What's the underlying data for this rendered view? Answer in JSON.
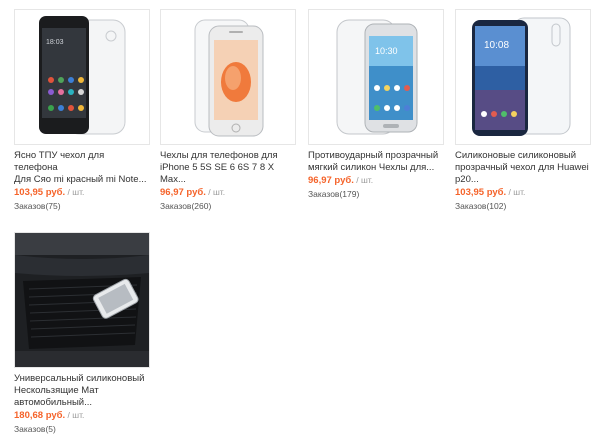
{
  "products": [
    {
      "title_lines": [
        "Ясно ТПУ чехол для телефона",
        "Для Сяо mi красный mi Note..."
      ],
      "price": "103,95 руб.",
      "unit": " / шт.",
      "orders": "Заказов(75)"
    },
    {
      "title_lines": [
        "Чехлы для телефонов для",
        "iPhone 5 5S SE 6 6S 7 8 X Max..."
      ],
      "price": "96,97 руб.",
      "unit": " / шт.",
      "orders": "Заказов(260)"
    },
    {
      "title_lines": [
        "Противоударный прозрачный",
        "мягкий силикон Чехлы для..."
      ],
      "price": "96,97 руб.",
      "unit": " / шт.",
      "orders": "Заказов(179)"
    },
    {
      "title_lines": [
        "Силиконовые силиконовый",
        "прозрачный чехол для Huawei",
        "p20..."
      ],
      "price": "103,95 руб.",
      "unit": " / шт.",
      "orders": "Заказов(102)"
    },
    {
      "title_lines": [
        "Универсальный силиконовый",
        "Нескользящие Мат",
        "автомобильный..."
      ],
      "price": "180,68 руб.",
      "unit": " / шт.",
      "orders": "Заказов(5)"
    }
  ],
  "colors": {
    "price": "#f5632a",
    "border": "#e6e6e6",
    "text": "#333333"
  }
}
